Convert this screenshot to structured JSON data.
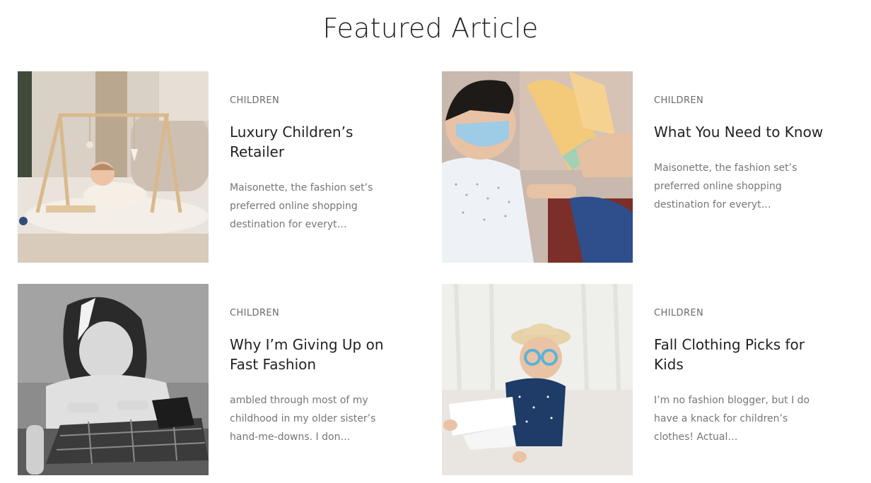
{
  "section": {
    "title": "Featured Article"
  },
  "articles": [
    {
      "category": "CHILDREN",
      "title": "Luxury Children’s Retailer",
      "excerpt": "Maisonette, the fashion set’s preferred online shopping destination for everyt…",
      "image": "baby-play-gym-photo"
    },
    {
      "category": "CHILDREN",
      "title": "What You Need to Know",
      "excerpt": "Maisonette, the fashion set’s preferred online shopping destination for everyt…",
      "image": "child-hand-sanitizer-photo"
    },
    {
      "category": "CHILDREN",
      "title": "Why I’m Giving Up on Fast Fashion",
      "excerpt": "ambled through most of my childhood in my older sister’s hand-me-downs. I don…",
      "image": "vintage-girl-sewing-photo"
    },
    {
      "category": "CHILDREN",
      "title": "Fall Clothing Picks for Kids",
      "excerpt": "I’m no fashion blogger, but I do have a knack for children’s clothes! Actual…",
      "image": "boy-with-glasses-photo"
    }
  ]
}
